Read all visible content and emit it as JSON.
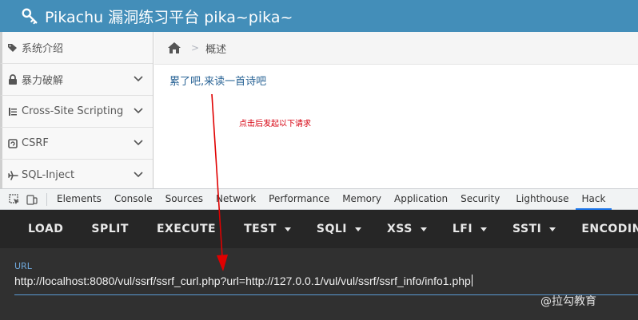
{
  "header": {
    "title": "Pikachu 漏洞练习平台 pika~pika~",
    "icon": "key-icon"
  },
  "sidebar": {
    "items": [
      {
        "label": "系统介绍",
        "icon": "tags-icon",
        "has_chevron": false
      },
      {
        "label": "暴力破解",
        "icon": "lock-icon",
        "has_chevron": true
      },
      {
        "label": "Cross-Site Scripting",
        "icon": "list-icon",
        "has_chevron": true
      },
      {
        "label": "CSRF",
        "icon": "refresh-icon",
        "has_chevron": true
      },
      {
        "label": "SQL-Inject",
        "icon": "plane-icon",
        "has_chevron": true
      }
    ]
  },
  "breadcrumb": {
    "current": "概述",
    "separator": ">"
  },
  "content": {
    "link_text": "累了吧,来读一首诗吧",
    "annotation": "点击后发起以下请求"
  },
  "devtools": {
    "tabs": [
      "Elements",
      "Console",
      "Sources",
      "Network",
      "Performance",
      "Memory",
      "Application",
      "Security",
      "Lighthouse",
      "Hack"
    ],
    "active_tab": "Hack"
  },
  "hackbar": {
    "buttons": [
      {
        "label": "LOAD",
        "dropdown": false
      },
      {
        "label": "SPLIT",
        "dropdown": false
      },
      {
        "label": "EXECUTE",
        "dropdown": false
      },
      {
        "label": "TEST",
        "dropdown": true
      },
      {
        "label": "SQLI",
        "dropdown": true
      },
      {
        "label": "XSS",
        "dropdown": true
      },
      {
        "label": "LFI",
        "dropdown": true
      },
      {
        "label": "SSTI",
        "dropdown": true
      },
      {
        "label": "ENCODING",
        "dropdown": false
      }
    ],
    "url_label": "URL",
    "url_value": "http://localhost:8080/vul/ssrf/ssrf_curl.php?url=http://127.0.0.1/vul/vul/ssrf/ssrf_info/info1.php"
  },
  "watermark": "@拉勾教育",
  "colors": {
    "header_bg": "#438eb9",
    "link": "#2a6496",
    "annotation": "#d6000f",
    "hackbar_bg": "#303030",
    "accent": "#5b9bd5"
  }
}
